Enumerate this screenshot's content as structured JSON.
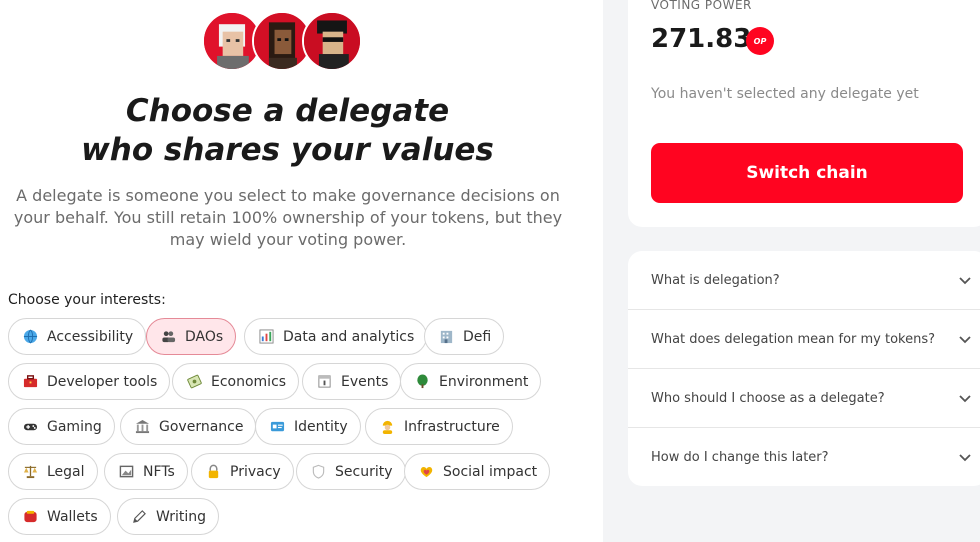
{
  "header": {
    "title_line1": "Choose a delegate",
    "title_line2": "who shares your values",
    "description": "A delegate is someone you select to make governance decisions on your behalf. You still retain 100% ownership of your tokens, but they may wield your voting power."
  },
  "interests": {
    "label": "Choose your interests:",
    "chips": [
      {
        "label": "Accessibility",
        "icon": "globe-icon",
        "selected": false
      },
      {
        "label": "DAOs",
        "icon": "people-icon",
        "selected": true
      },
      {
        "label": "Data and analytics",
        "icon": "bar-chart-icon",
        "selected": false
      },
      {
        "label": "Defi",
        "icon": "bank-icon",
        "selected": false
      },
      {
        "label": "Developer tools",
        "icon": "toolbox-icon",
        "selected": false
      },
      {
        "label": "Economics",
        "icon": "money-icon",
        "selected": false
      },
      {
        "label": "Events",
        "icon": "calendar-icon",
        "selected": false
      },
      {
        "label": "Environment",
        "icon": "tree-icon",
        "selected": false
      },
      {
        "label": "Gaming",
        "icon": "gamepad-icon",
        "selected": false
      },
      {
        "label": "Governance",
        "icon": "building-icon",
        "selected": false
      },
      {
        "label": "Identity",
        "icon": "id-card-icon",
        "selected": false
      },
      {
        "label": "Infrastructure",
        "icon": "worker-icon",
        "selected": false
      },
      {
        "label": "Legal",
        "icon": "scales-icon",
        "selected": false
      },
      {
        "label": "NFTs",
        "icon": "frame-icon",
        "selected": false
      },
      {
        "label": "Privacy",
        "icon": "lock-icon",
        "selected": false
      },
      {
        "label": "Security",
        "icon": "shield-icon",
        "selected": false
      },
      {
        "label": "Social impact",
        "icon": "heart-hands-icon",
        "selected": false
      },
      {
        "label": "Wallets",
        "icon": "wallet-icon",
        "selected": false
      },
      {
        "label": "Writing",
        "icon": "pen-icon",
        "selected": false
      }
    ]
  },
  "voting": {
    "label": "VOTING POWER",
    "value": "271.83",
    "token": "OP",
    "status": "You haven't selected any delegate yet",
    "button": "Switch chain"
  },
  "faq": [
    "What is delegation?",
    "What does delegation mean for my tokens?",
    "Who should I choose as a delegate?",
    "How do I change this later?"
  ],
  "colors": {
    "accent": "#ff0420",
    "selected_chip_bg": "#ffe6ea",
    "right_panel_bg": "#f3f4f6"
  }
}
